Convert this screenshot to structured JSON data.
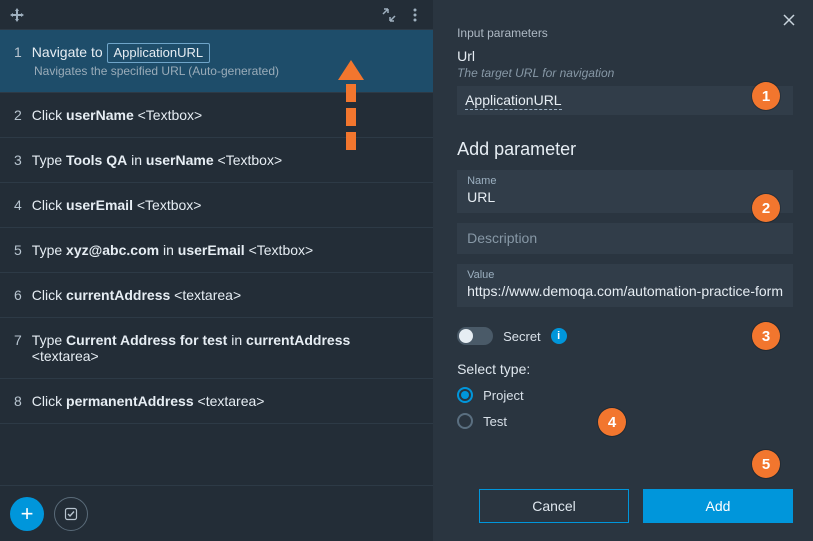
{
  "left": {
    "steps": [
      {
        "num": "1",
        "pre": "Navigate to ",
        "paramBox": "ApplicationURL",
        "desc": "Navigates the specified URL (Auto-generated)",
        "selected": true
      },
      {
        "num": "2",
        "pre": "Click ",
        "bold": "userName",
        "post": " <Textbox>"
      },
      {
        "num": "3",
        "pre": "Type ",
        "bold": "Tools QA",
        "mid": " in ",
        "bold2": "userName",
        "post": " <Textbox>"
      },
      {
        "num": "4",
        "pre": "Click ",
        "bold": "userEmail",
        "post": " <Textbox>"
      },
      {
        "num": "5",
        "pre": "Type ",
        "bold": "xyz@abc.com",
        "mid": " in ",
        "bold2": "userEmail",
        "post": " <Textbox>"
      },
      {
        "num": "6",
        "pre": "Click ",
        "bold": "currentAddress",
        "post": " <textarea>"
      },
      {
        "num": "7",
        "pre": "Type ",
        "bold": "Current Address for test",
        "mid": " in ",
        "bold2": "currentAddress",
        "post": " <textarea>"
      },
      {
        "num": "8",
        "pre": "Click ",
        "bold": "permanentAddress",
        "post": " <textarea>"
      }
    ]
  },
  "right": {
    "section_header": "Input parameters",
    "url_label": "Url",
    "url_hint": "The target URL for navigation",
    "url_value": "ApplicationURL",
    "add_param_header": "Add parameter",
    "name_label": "Name",
    "name_value": "URL",
    "desc_placeholder": "Description",
    "value_label": "Value",
    "value_value": "https://www.demoqa.com/automation-practice-form",
    "secret_label": "Secret",
    "select_type_header": "Select type:",
    "type_project": "Project",
    "type_test": "Test",
    "cancel": "Cancel",
    "add": "Add"
  },
  "markers": {
    "m1": "1",
    "m2": "2",
    "m3": "3",
    "m4": "4",
    "m5": "5"
  }
}
